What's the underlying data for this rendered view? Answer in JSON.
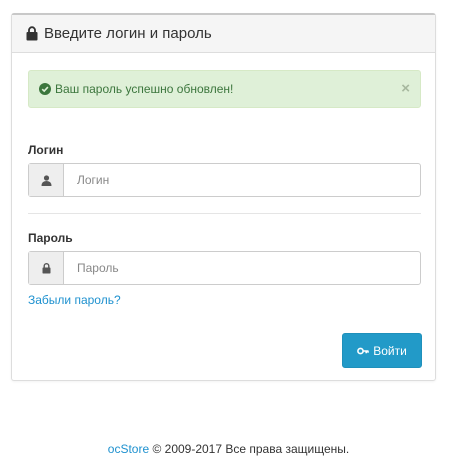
{
  "panel": {
    "title": "Введите логин и пароль"
  },
  "alert": {
    "message": "Ваш пароль успешно обновлен!",
    "close_label": "×"
  },
  "form": {
    "login_label": "Логин",
    "login_placeholder": "Логин",
    "login_value": "",
    "password_label": "Пароль",
    "password_placeholder": "Пароль",
    "password_value": "",
    "forgot_link": "Забыли пароль?",
    "submit_label": "Войти"
  },
  "footer": {
    "brand_link": "ocStore",
    "copyright": "© 2009-2017 Все права защищены."
  },
  "icons": {
    "heading": "lock-icon",
    "alert": "check-circle-icon",
    "login": "user-icon",
    "password": "lock-icon",
    "submit": "key-icon"
  },
  "colors": {
    "accent": "#229ac8",
    "link": "#1e91cf",
    "success_bg": "#dff0d8",
    "success_text": "#3c763d"
  }
}
